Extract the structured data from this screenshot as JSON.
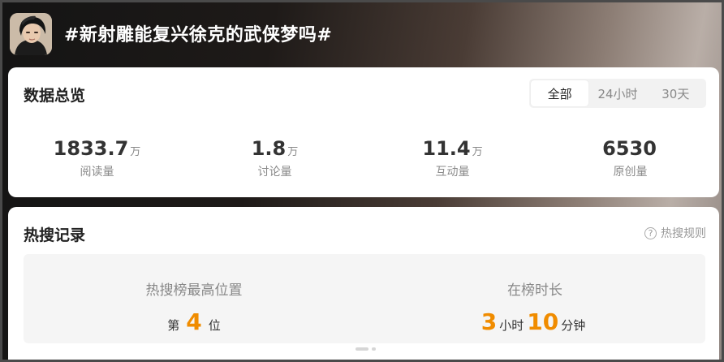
{
  "header": {
    "title": "#新射雕能复兴徐克的武侠梦吗#"
  },
  "overview": {
    "title": "数据总览",
    "tabs": [
      "全部",
      "24小时",
      "30天"
    ],
    "active_tab": "全部",
    "stats": [
      {
        "value": "1833.7",
        "unit": "万",
        "label": "阅读量"
      },
      {
        "value": "1.8",
        "unit": "万",
        "label": "讨论量"
      },
      {
        "value": "11.4",
        "unit": "万",
        "label": "互动量"
      },
      {
        "value": "6530",
        "unit": "",
        "label": "原创量"
      }
    ]
  },
  "hot": {
    "title": "热搜记录",
    "rules_label": "热搜规则",
    "rules_icon": "?",
    "peak": {
      "title": "热搜榜最高位置",
      "prefix": "第",
      "value": "4",
      "suffix": "位"
    },
    "duration": {
      "title": "在榜时长",
      "hours": "3",
      "hours_unit": "小时",
      "minutes": "10",
      "minutes_unit": "分钟"
    }
  },
  "colors": {
    "accent": "#f08c00"
  }
}
